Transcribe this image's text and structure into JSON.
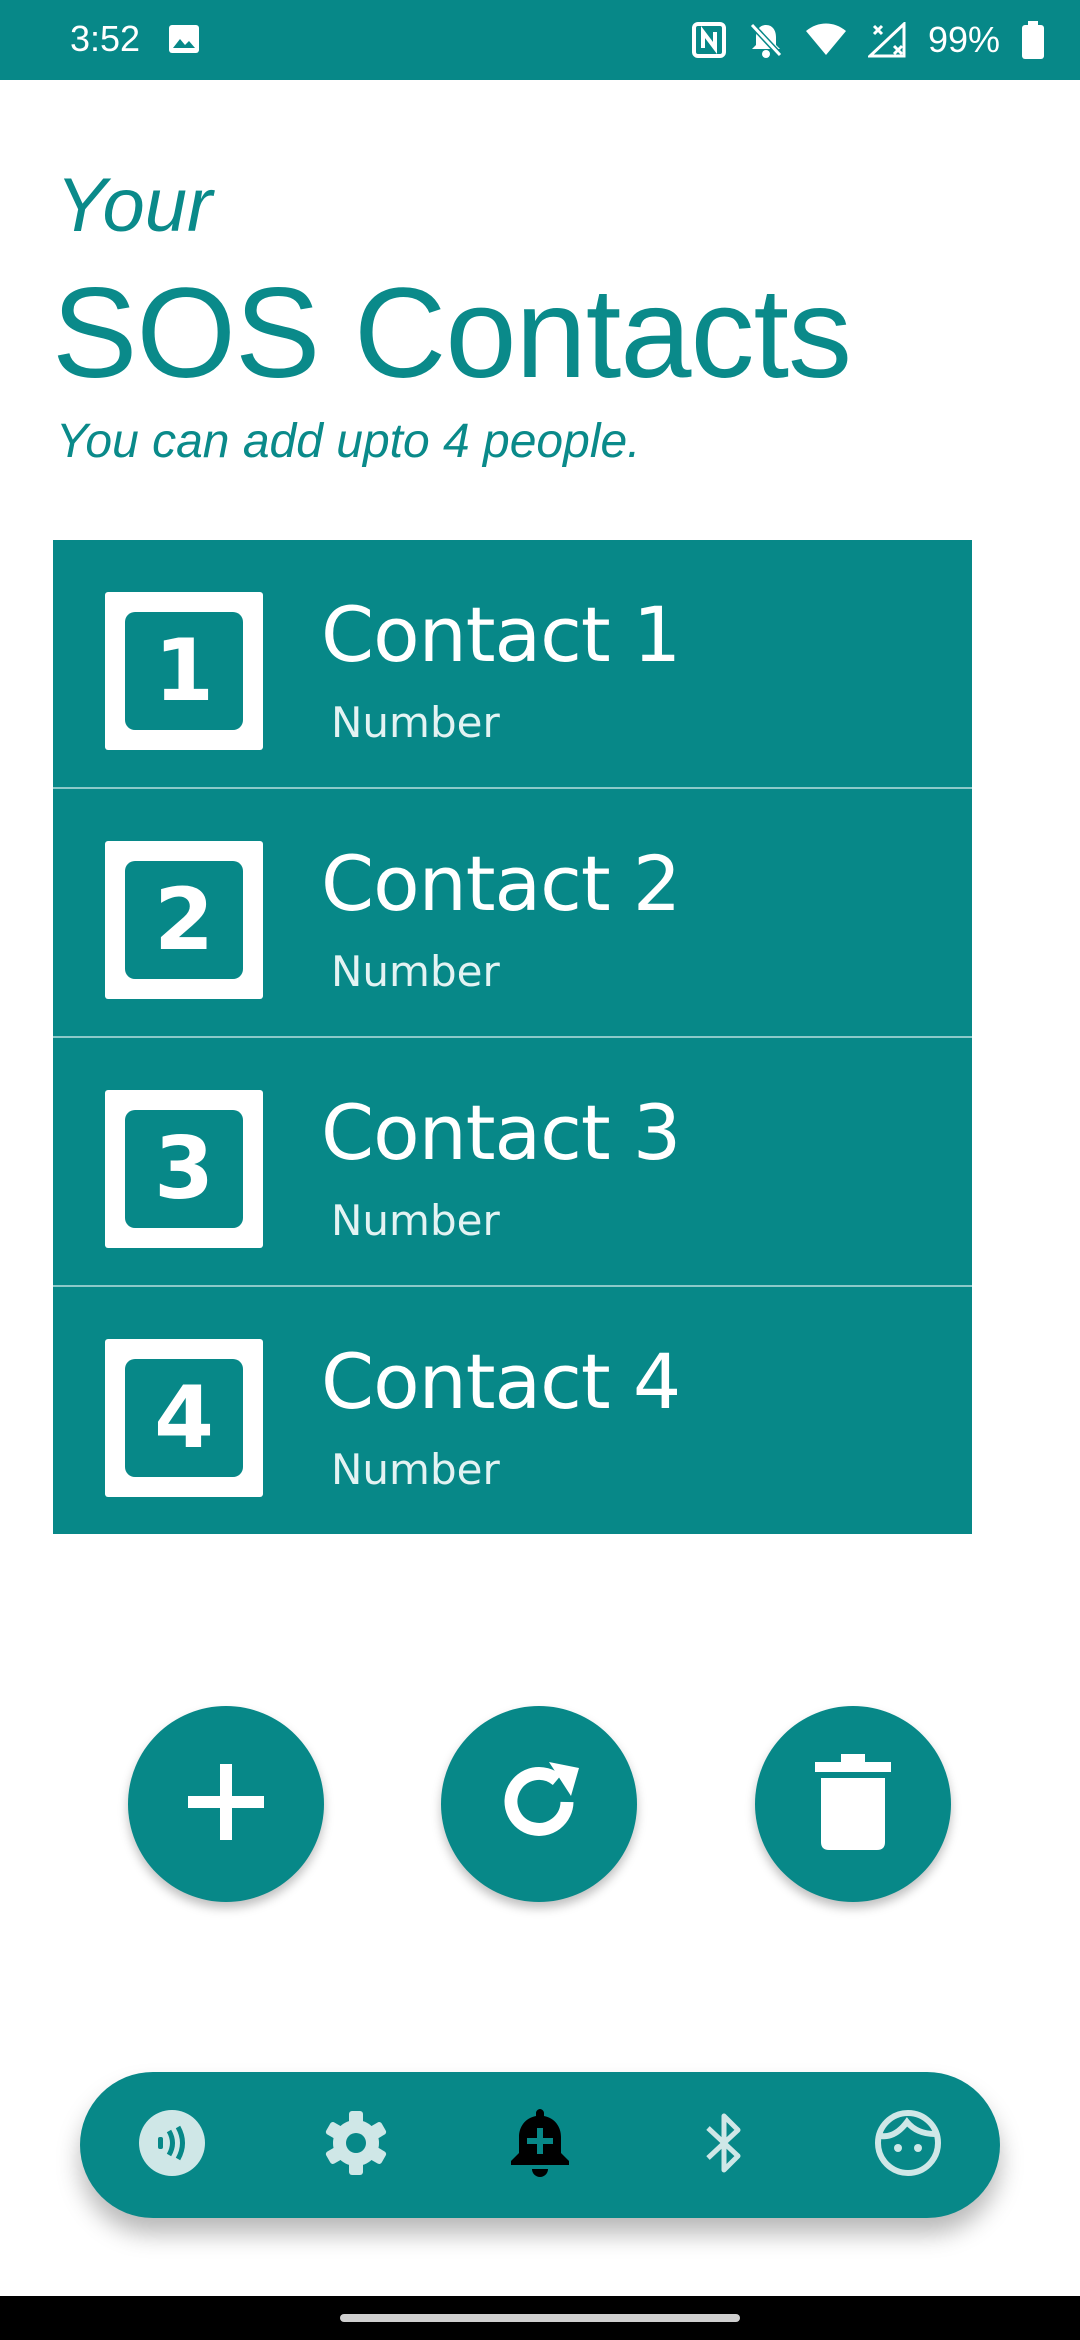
{
  "status_bar": {
    "time": "3:52",
    "battery_percent": "99%",
    "icons": [
      "image-icon",
      "nfc-icon",
      "bell-off-icon",
      "wifi-icon",
      "no-signal-icon",
      "battery-icon"
    ]
  },
  "header": {
    "eyebrow": "Your",
    "title": "SOS Contacts",
    "subtitle": "You can add upto 4 people."
  },
  "contacts": [
    {
      "index": "1",
      "name": "Contact 1",
      "number": "Number"
    },
    {
      "index": "2",
      "name": "Contact 2",
      "number": "Number"
    },
    {
      "index": "3",
      "name": "Contact 3",
      "number": "Number"
    },
    {
      "index": "4",
      "name": "Contact 4",
      "number": "Number"
    }
  ],
  "actions": [
    {
      "icon": "plus-icon"
    },
    {
      "icon": "refresh-icon"
    },
    {
      "icon": "trash-icon"
    }
  ],
  "bottom_nav": {
    "items": [
      {
        "icon": "nfc-contactless-icon",
        "active": false
      },
      {
        "icon": "gear-icon",
        "active": false
      },
      {
        "icon": "bell-plus-icon",
        "active": true
      },
      {
        "icon": "bluetooth-icon",
        "active": false
      },
      {
        "icon": "face-icon",
        "active": false
      }
    ]
  },
  "colors": {
    "primary": "#078888",
    "background": "#ffffff",
    "active_nav_icon": "#000000",
    "inactive_nav_icon": "#cfe7e7"
  }
}
